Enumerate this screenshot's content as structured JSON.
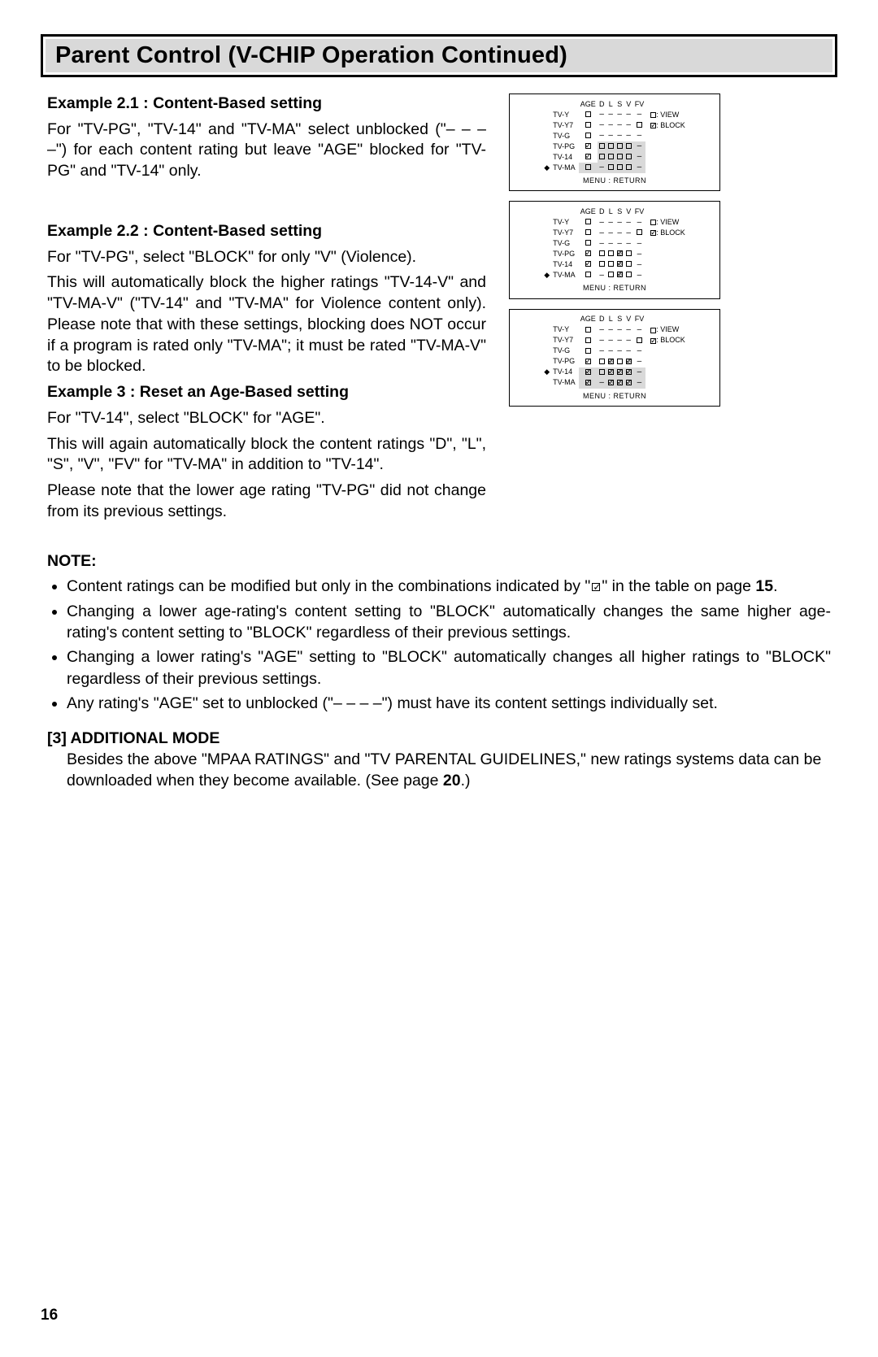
{
  "page_title": "Parent Control (V-CHIP Operation Continued)",
  "page_number": "16",
  "example1": {
    "title": "Example 2.1 : Content-Based setting",
    "body": "For \"TV-PG\", \"TV-14\" and \"TV-MA\" select unblocked  (\"– – – –\") for each content rating but leave \"AGE\" blocked for \"TV-PG\" and \"TV-14\" only."
  },
  "example2": {
    "title": "Example 2.2 : Content-Based setting",
    "body1": "For \"TV-PG\", select \"BLOCK\" for only \"V\" (Violence).",
    "body2": "This will automatically block the higher ratings \"TV-14-V\" and \"TV-MA-V\"  (\"TV-14\" and \"TV-MA\" for Violence content only). Please note that with these settings, blocking does NOT occur if a program is rated only \"TV-MA\"; it must be rated \"TV-MA-V\" to be blocked."
  },
  "example3": {
    "title": "Example 3 : Reset an Age-Based setting",
    "body1": "For \"TV-14\", select \"BLOCK\" for \"AGE\".",
    "body2": "This will again automatically block the content ratings \"D\", \"L\", \"S\", \"V\", \"FV\" for \"TV-MA\" in addition to \"TV-14\".",
    "body3": "Please note that the lower age rating \"TV-PG\" did not change from its previous settings."
  },
  "note_label": "NOTE:",
  "notes": [
    {
      "pre": "Content ratings can be modified but only in the combinations indicated by \"",
      "post": "\" in the table on page ",
      "page": "15",
      "tail": "."
    },
    {
      "text": "Changing a lower age-rating's content setting to \"BLOCK\" automatically changes the same higher age-rating's content setting to \"BLOCK\" regardless of their previous settings."
    },
    {
      "text": "Changing a lower rating's \"AGE\" setting to \"BLOCK\"  automatically changes all higher ratings to \"BLOCK\" regardless of their previous settings."
    },
    {
      "text": "Any rating's \"AGE\" set to unblocked (\"– – – –\") must have its content settings individually set."
    }
  ],
  "additional": {
    "heading": "[3] ADDITIONAL MODE",
    "body_pre": "Besides the above \"MPAA RATINGS\" and \"TV PARENTAL GUIDELINES,\" new ratings systems data can be downloaded when they become available. (See page ",
    "body_page": "20",
    "body_post": ".)"
  },
  "diagrams": {
    "columns": [
      "AGE",
      "D",
      "L",
      "S",
      "V",
      "FV"
    ],
    "legend_view": ": VIEW",
    "legend_block": ": BLOCK",
    "footer": "MENU : RETURN",
    "d1": {
      "rows": [
        {
          "label": "TV-Y",
          "arrow": "",
          "cells": [
            "empty",
            "dash",
            "dash",
            "dash",
            "dash",
            "dash"
          ]
        },
        {
          "label": "TV-Y7",
          "arrow": "",
          "cells": [
            "empty",
            "dash",
            "dash",
            "dash",
            "dash",
            "empty"
          ]
        },
        {
          "label": "TV-G",
          "arrow": "",
          "cells": [
            "empty",
            "dash",
            "dash",
            "dash",
            "dash",
            "dash"
          ]
        },
        {
          "label": "TV-PG",
          "arrow": "",
          "cells": [
            "block",
            "empty",
            "empty",
            "empty",
            "empty",
            "dash"
          ],
          "shade": "content"
        },
        {
          "label": "TV-14",
          "arrow": "",
          "cells": [
            "block",
            "empty",
            "empty",
            "empty",
            "empty",
            "dash"
          ],
          "shade": "content"
        },
        {
          "label": "TV-MA",
          "arrow": "◆",
          "cells": [
            "empty",
            "dash",
            "empty",
            "empty",
            "empty",
            "dash"
          ],
          "shade": "full"
        }
      ]
    },
    "d2": {
      "rows": [
        {
          "label": "TV-Y",
          "arrow": "",
          "cells": [
            "empty",
            "dash",
            "dash",
            "dash",
            "dash",
            "dash"
          ]
        },
        {
          "label": "TV-Y7",
          "arrow": "",
          "cells": [
            "empty",
            "dash",
            "dash",
            "dash",
            "dash",
            "empty"
          ]
        },
        {
          "label": "TV-G",
          "arrow": "",
          "cells": [
            "empty",
            "dash",
            "dash",
            "dash",
            "dash",
            "dash"
          ]
        },
        {
          "label": "TV-PG",
          "arrow": "",
          "cells": [
            "block",
            "empty",
            "empty",
            "hatch",
            "empty",
            "dash"
          ]
        },
        {
          "label": "TV-14",
          "arrow": "",
          "cells": [
            "block",
            "empty",
            "empty",
            "hatch",
            "empty",
            "dash"
          ]
        },
        {
          "label": "TV-MA",
          "arrow": "◆",
          "cells": [
            "empty",
            "dash",
            "empty",
            "hatch",
            "empty",
            "dash"
          ]
        }
      ]
    },
    "d3": {
      "rows": [
        {
          "label": "TV-Y",
          "arrow": "",
          "cells": [
            "empty",
            "dash",
            "dash",
            "dash",
            "dash",
            "dash"
          ]
        },
        {
          "label": "TV-Y7",
          "arrow": "",
          "cells": [
            "empty",
            "dash",
            "dash",
            "dash",
            "dash",
            "empty"
          ]
        },
        {
          "label": "TV-G",
          "arrow": "",
          "cells": [
            "empty",
            "dash",
            "dash",
            "dash",
            "dash",
            "dash"
          ]
        },
        {
          "label": "TV-PG",
          "arrow": "",
          "cells": [
            "block",
            "empty",
            "hatch",
            "empty",
            "hatch",
            "dash"
          ]
        },
        {
          "label": "TV-14",
          "arrow": "◆",
          "cells": [
            "hatch",
            "empty",
            "hatch",
            "hatch",
            "hatch",
            "dash"
          ],
          "shade": "full"
        },
        {
          "label": "TV-MA",
          "arrow": "",
          "cells": [
            "hatch",
            "dash",
            "hatch",
            "hatch",
            "hatch",
            "dash"
          ],
          "shade": "full"
        }
      ]
    }
  }
}
